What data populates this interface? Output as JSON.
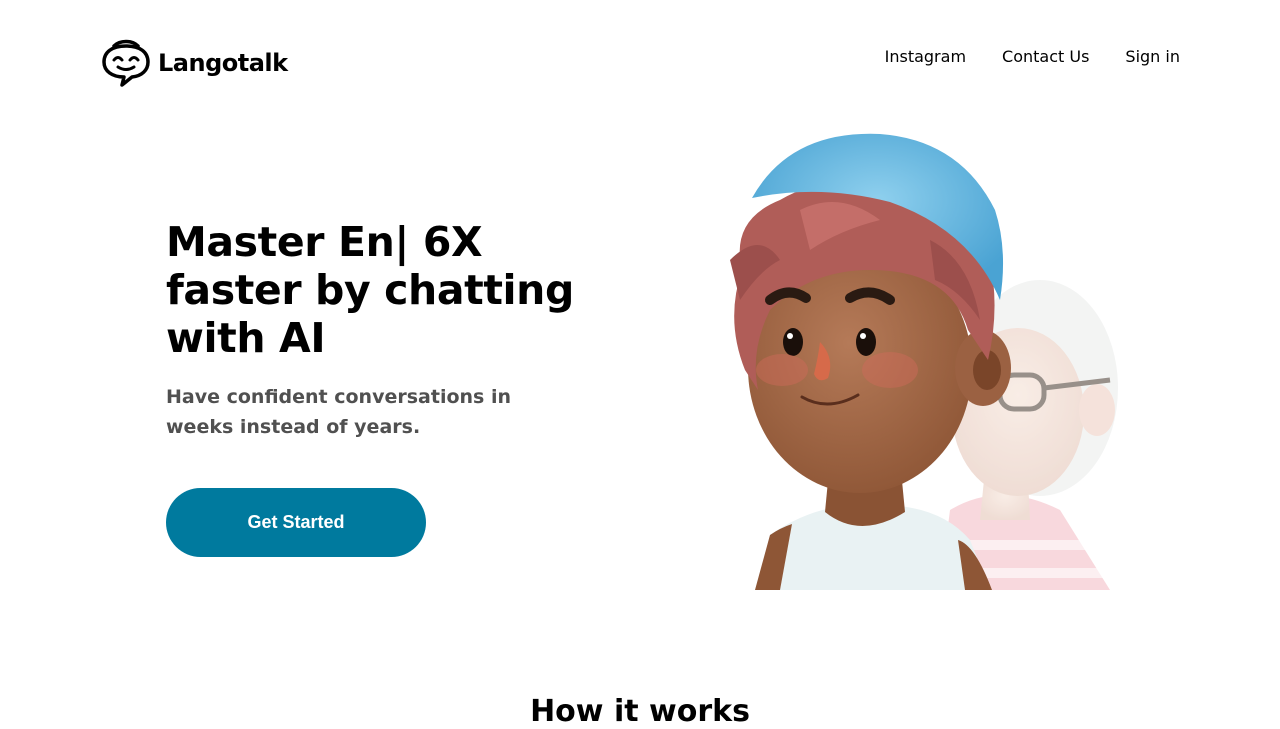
{
  "brand": {
    "name": "Langotalk",
    "icon": "chat-bubble-face-icon"
  },
  "nav": {
    "items": [
      {
        "label": "Instagram"
      },
      {
        "label": "Contact Us"
      },
      {
        "label": "Sign in"
      }
    ]
  },
  "hero": {
    "title": "Master En| 6X faster by chatting with AI",
    "subtitle": "Have confident conversations in weeks instead of years.",
    "cta_label": "Get Started",
    "illustration": "two-3d-avatars-illustration"
  },
  "how_it_works": {
    "title": "How it works"
  },
  "colors": {
    "accent": "#007a9e",
    "text": "#000000",
    "subtext": "#505050"
  }
}
